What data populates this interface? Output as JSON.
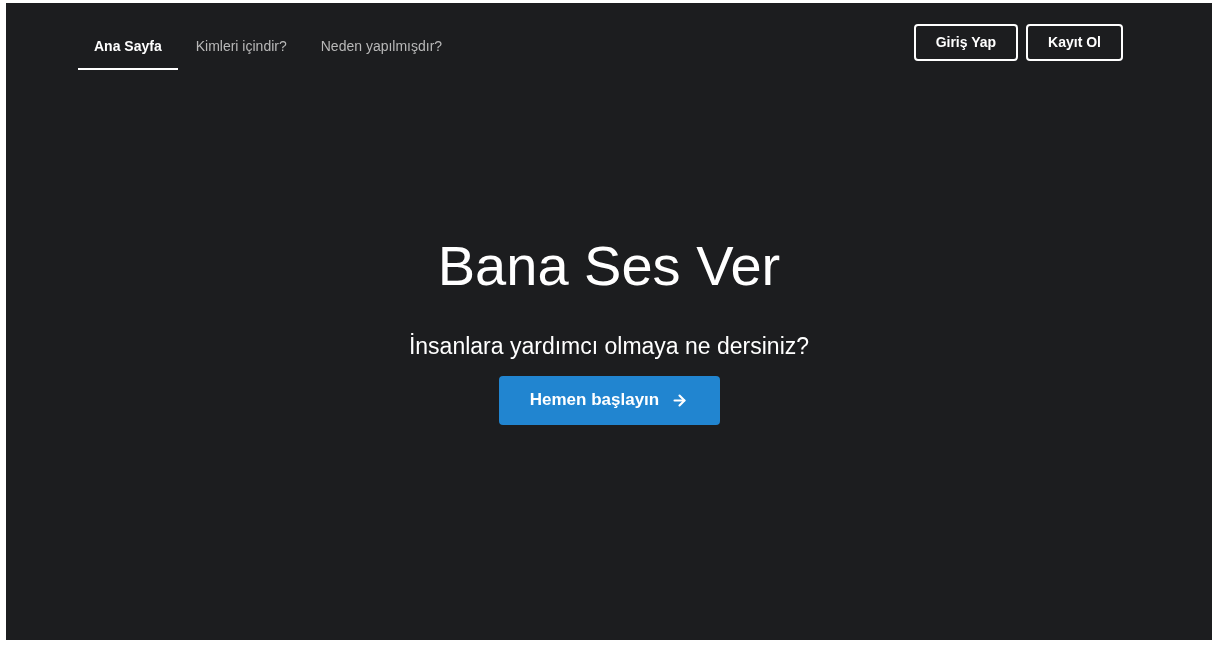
{
  "nav": {
    "items": [
      {
        "label": "Ana Sayfa",
        "selected": true
      },
      {
        "label": "Kimleri içindir?",
        "selected": false
      },
      {
        "label": "Neden yapılmışdır?",
        "selected": false
      }
    ]
  },
  "auth_buttons": [
    "Giriş Yap",
    "Kayıt Ol"
  ],
  "hero": {
    "title": "Bana Ses Ver",
    "subtitle": "İnsanlara yardımcı olmaya ne dersiniz?",
    "cta": "Hemen başlayın"
  }
}
